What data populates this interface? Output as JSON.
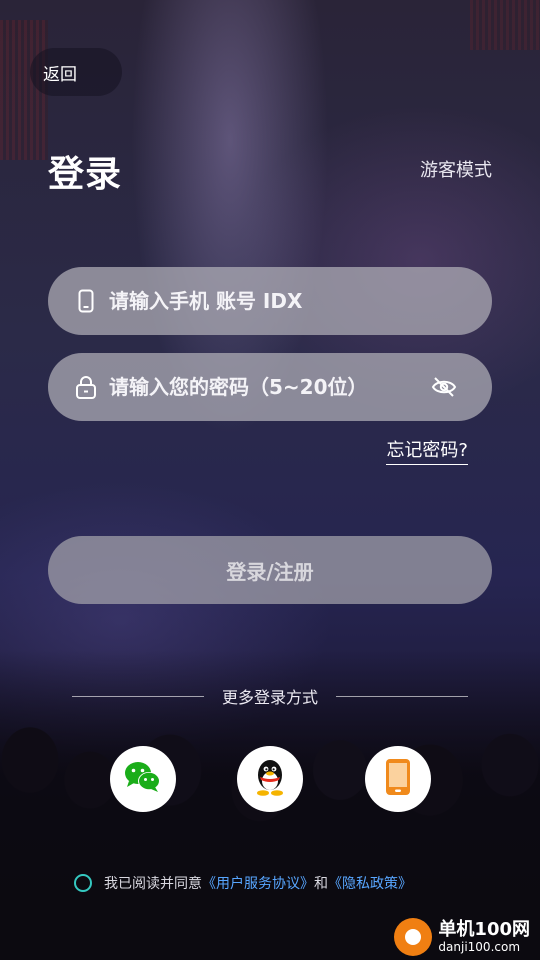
{
  "header": {
    "back_label": "返回",
    "title": "登录",
    "guest_mode": "游客模式"
  },
  "form": {
    "account_placeholder": "请输入手机 账号 IDX",
    "password_placeholder": "请输入您的密码（5~20位）",
    "forgot_password": "忘记密码?",
    "submit_label": "登录/注册"
  },
  "social": {
    "label": "更多登录方式",
    "options": [
      {
        "name": "wechat",
        "icon": "wechat-icon",
        "color": "#1aad19"
      },
      {
        "name": "qq",
        "icon": "qq-penguin-icon",
        "color": "#000000"
      },
      {
        "name": "phone",
        "icon": "phone-icon",
        "color": "#f08a1c"
      }
    ]
  },
  "agreement": {
    "prefix": "我已阅读并同意",
    "user_agreement": "《用户服务协议》",
    "conjunction": "和",
    "privacy_policy": "《隐私政策》"
  },
  "watermark": {
    "title": "单机100网",
    "domain": "danji100.com"
  },
  "colors": {
    "accent_link": "#58a6ff",
    "radio_border": "#35c8c0"
  }
}
